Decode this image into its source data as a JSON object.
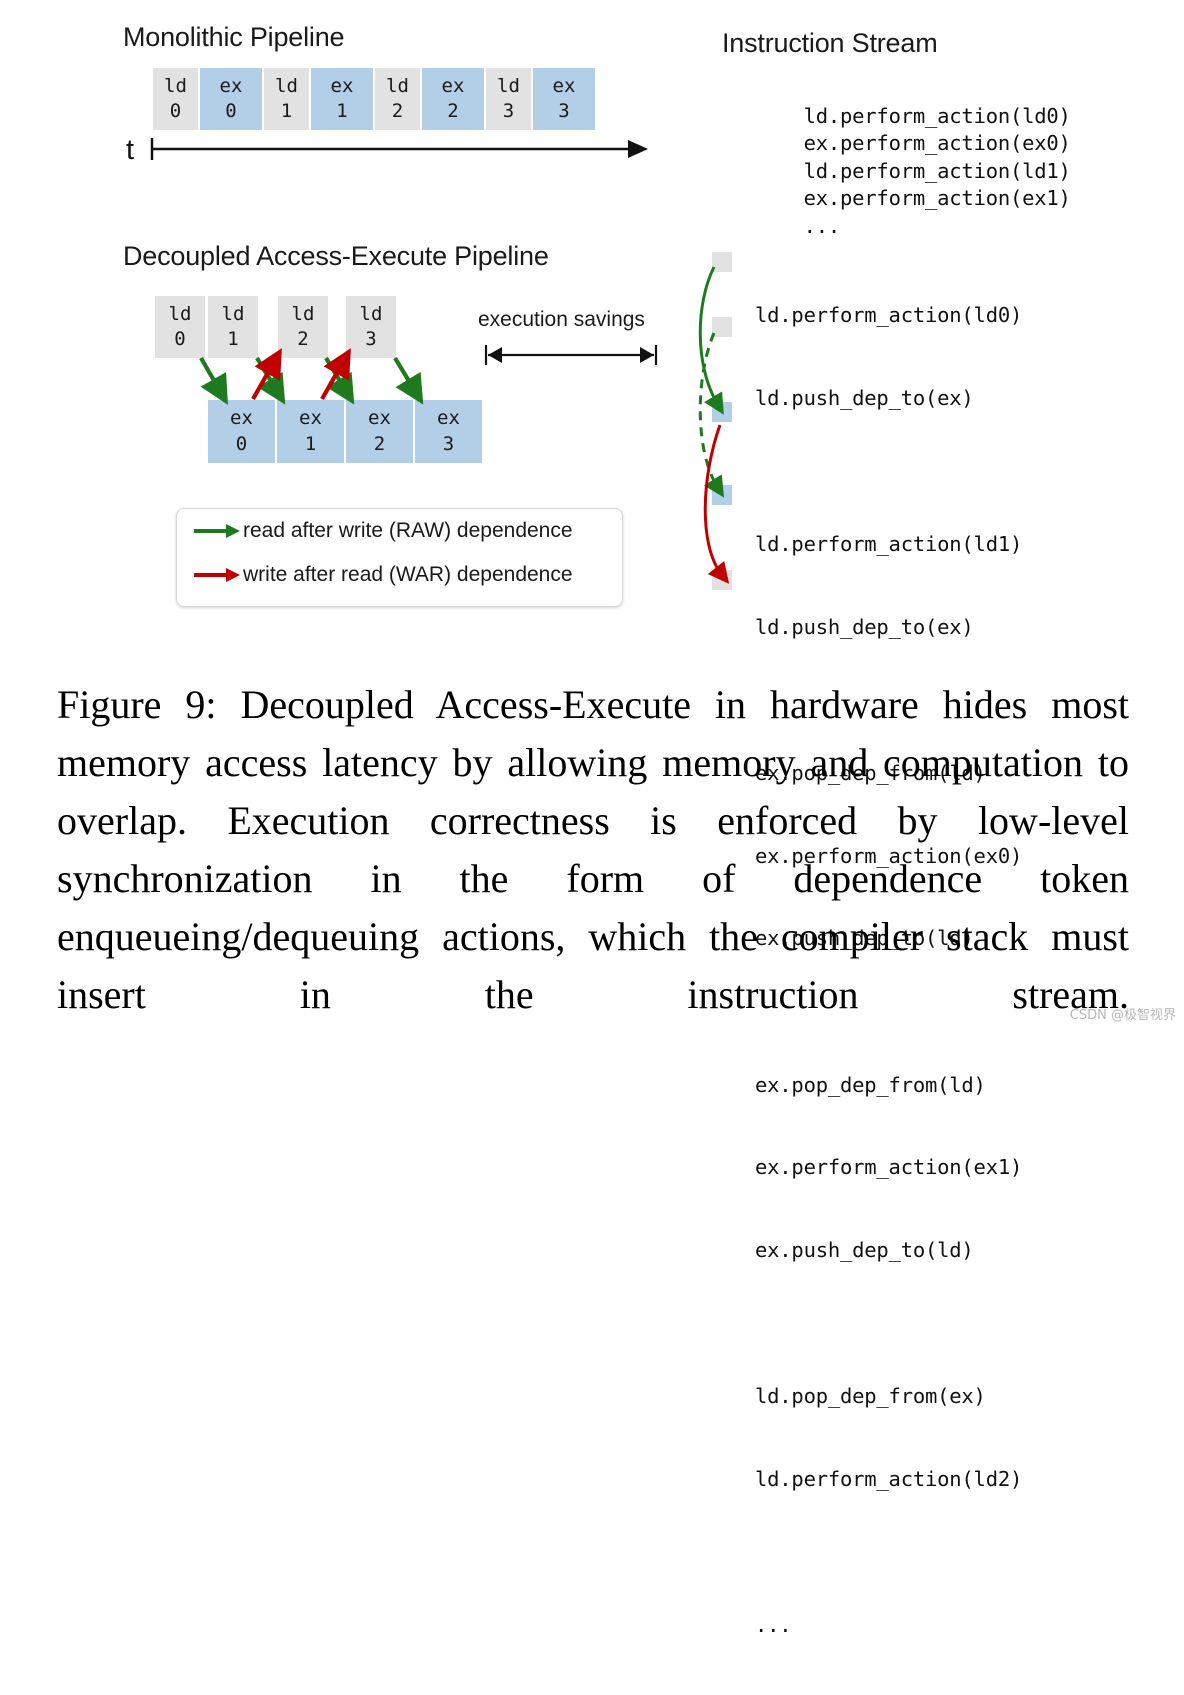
{
  "figure": {
    "mono": {
      "title": "Monolithic Pipeline",
      "time_axis_label": "t",
      "blocks": [
        {
          "kind": "ld",
          "name": "ld",
          "index": "0"
        },
        {
          "kind": "ex",
          "name": "ex",
          "index": "0"
        },
        {
          "kind": "ld",
          "name": "ld",
          "index": "1"
        },
        {
          "kind": "ex",
          "name": "ex",
          "index": "1"
        },
        {
          "kind": "ld",
          "name": "ld",
          "index": "2"
        },
        {
          "kind": "ex",
          "name": "ex",
          "index": "2"
        },
        {
          "kind": "ld",
          "name": "ld",
          "index": "3"
        },
        {
          "kind": "ex",
          "name": "ex",
          "index": "3"
        }
      ]
    },
    "decoupled": {
      "title": "Decoupled Access-Execute Pipeline",
      "ld_blocks": [
        {
          "name": "ld",
          "index": "0"
        },
        {
          "name": "ld",
          "index": "1"
        },
        {
          "name": "ld",
          "index": "2"
        },
        {
          "name": "ld",
          "index": "3"
        }
      ],
      "ex_blocks": [
        {
          "name": "ex",
          "index": "0"
        },
        {
          "name": "ex",
          "index": "1"
        },
        {
          "name": "ex",
          "index": "2"
        },
        {
          "name": "ex",
          "index": "3"
        }
      ],
      "savings_label": "execution savings"
    },
    "legend": {
      "raw": "read after write  (RAW) dependence",
      "war": "write after read  (WAR) dependence"
    },
    "stream": {
      "title": "Instruction Stream",
      "mono_lines": [
        "ld.perform_action(ld0)",
        "ex.perform_action(ex0)",
        "ld.perform_action(ld1)",
        "ex.perform_action(ex1)",
        "..."
      ],
      "dae_groups": [
        [
          "ld.perform_action(ld0)",
          "ld.push_dep_to(ex)"
        ],
        [
          "ld.perform_action(ld1)",
          "ld.push_dep_to(ex)"
        ],
        [
          "ex.pop_dep_from(ld)",
          "ex.perform_action(ex0)",
          "ex.push_dep_to(ld)"
        ],
        [
          "ex.pop_dep_from(ld)",
          "ex.perform_action(ex1)",
          "ex.push_dep_to(ld)"
        ],
        [
          "ld.pop_dep_from(ex)",
          "ld.perform_action(ld2)"
        ],
        [
          "..."
        ]
      ]
    },
    "colors": {
      "ld_block": "#e2e2e2",
      "ex_block": "#b3cfe8",
      "raw_arrow": "#1f7a1f",
      "war_arrow": "#c00000",
      "text": "#1a1a1a"
    }
  },
  "caption": {
    "text": "Figure 9: Decoupled Access-Execute in hardware hides most memory access latency by allowing memory and computation to overlap.  Execution correctness is enforced by low-level synchronization in the form of dependence token enqueueing/dequeuing actions, which the compiler stack must insert in the instruction stream."
  },
  "watermark": {
    "text": "CSDN @极智视界"
  }
}
